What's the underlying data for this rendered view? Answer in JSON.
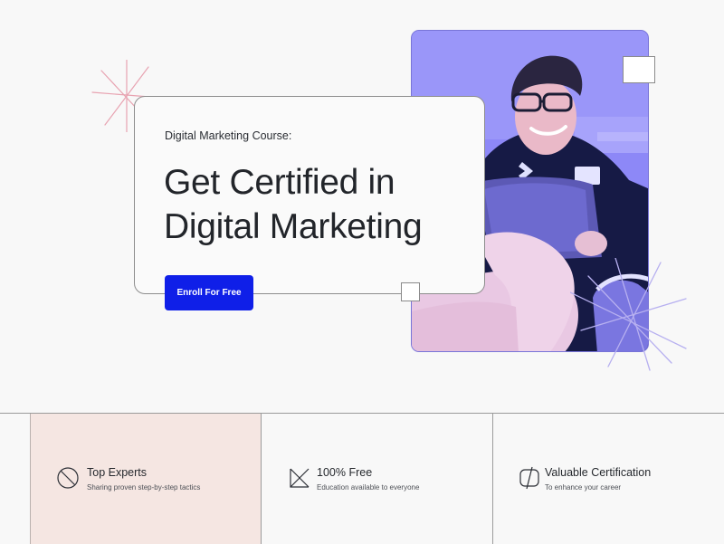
{
  "colors": {
    "background": "#f8f8f8",
    "accent_blue": "#0f1fe8",
    "photo_tint": "#8b86f6",
    "feature_highlight": "#f5e6e2",
    "sparkle_pink": "#e8a3b1",
    "sparkle_lilac": "#b7b0f0"
  },
  "hero": {
    "eyebrow": "Digital Marketing Course:",
    "title_line1": "Get Certified in",
    "title_line2": "Digital Marketing",
    "cta_label": "Enroll For Free",
    "photo_icon": "student-with-laptop-photo"
  },
  "features": [
    {
      "icon": "no-symbol-icon",
      "title": "Top Experts",
      "subtitle": "Sharing proven step-by-step tactics"
    },
    {
      "icon": "crossed-square-icon",
      "title": "100% Free",
      "subtitle": "Education available to everyone"
    },
    {
      "icon": "certificate-icon",
      "title": "Valuable Certification",
      "subtitle": "To enhance your career"
    }
  ]
}
